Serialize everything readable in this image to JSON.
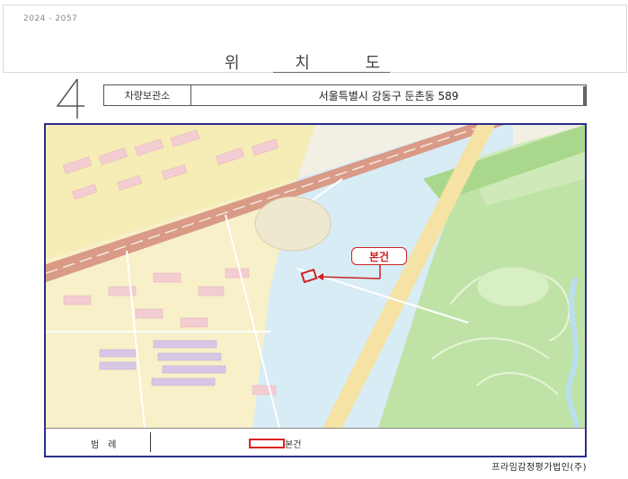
{
  "header": {
    "doc_code": "2024 - 2057",
    "title": "위 치 도"
  },
  "address": {
    "label": "차량보관소",
    "value": "서울특별시 강동구 둔촌동 589"
  },
  "map": {
    "callout_label": "본건",
    "colors": {
      "highway": "#d99a86",
      "park": "#bfe3a7",
      "residential_yellow": "#f6ecb6",
      "residential_pink": "#f3cdd2",
      "water_blue": "#d8ecf5",
      "marker": "#cc2222"
    }
  },
  "legend": {
    "title": "범례",
    "subject_label": "본건"
  },
  "footer": {
    "company": "프라임감정평가법인(주)"
  }
}
